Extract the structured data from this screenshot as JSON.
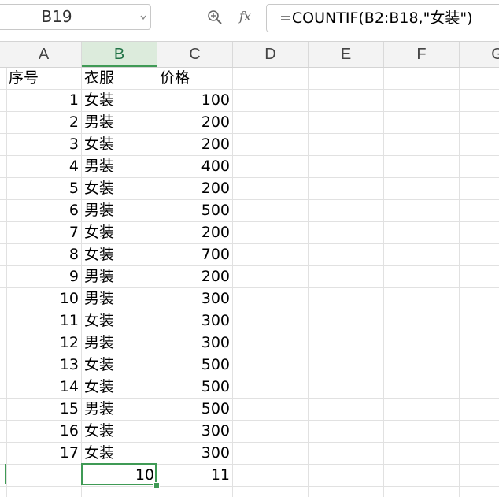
{
  "name_box": {
    "value": "B19"
  },
  "formula_bar": {
    "fx_label": "fx",
    "formula": "=COUNTIF(B2:B18,\"女装\")"
  },
  "columns": [
    "A",
    "B",
    "C",
    "D",
    "E",
    "F",
    "G"
  ],
  "active_column": "B",
  "header_row": {
    "a": "序号",
    "b": "衣服",
    "c": "价格"
  },
  "rows": [
    {
      "a": "1",
      "b": "女装",
      "c": "100"
    },
    {
      "a": "2",
      "b": "男装",
      "c": "200"
    },
    {
      "a": "3",
      "b": "女装",
      "c": "200"
    },
    {
      "a": "4",
      "b": "男装",
      "c": "400"
    },
    {
      "a": "5",
      "b": "女装",
      "c": "200"
    },
    {
      "a": "6",
      "b": "男装",
      "c": "500"
    },
    {
      "a": "7",
      "b": "女装",
      "c": "200"
    },
    {
      "a": "8",
      "b": "女装",
      "c": "700"
    },
    {
      "a": "9",
      "b": "男装",
      "c": "200"
    },
    {
      "a": "10",
      "b": "男装",
      "c": "300"
    },
    {
      "a": "11",
      "b": "女装",
      "c": "300"
    },
    {
      "a": "12",
      "b": "男装",
      "c": "300"
    },
    {
      "a": "13",
      "b": "女装",
      "c": "500"
    },
    {
      "a": "14",
      "b": "女装",
      "c": "500"
    },
    {
      "a": "15",
      "b": "男装",
      "c": "500"
    },
    {
      "a": "16",
      "b": "女装",
      "c": "300"
    },
    {
      "a": "17",
      "b": "女装",
      "c": "300"
    }
  ],
  "result_row": {
    "b": "10",
    "c": "11"
  },
  "icons": {
    "name_box_dropdown": "chevron-down-icon",
    "zoom": "zoom-formula-icon",
    "function": "fx-icon"
  },
  "colors": {
    "accent": "#3f9a55",
    "header_bg": "#f3f3f3",
    "gridline": "#e1e1e1"
  }
}
